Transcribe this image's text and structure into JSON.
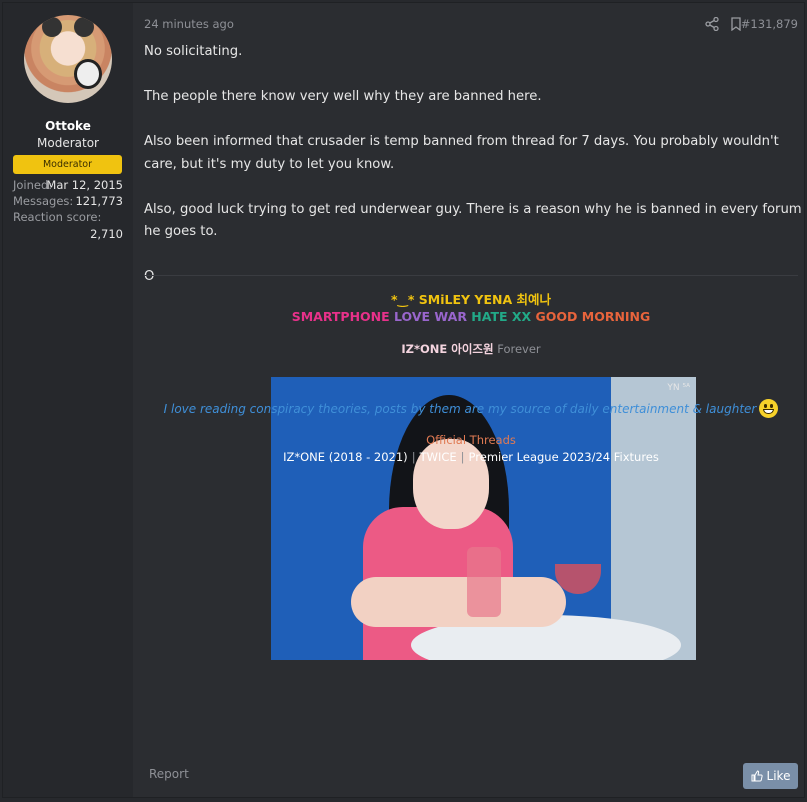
{
  "user": {
    "name": "Ottoke",
    "title": "Moderator",
    "banner": "Moderator",
    "stats": [
      {
        "label": "Joined:",
        "value": "Mar 12, 2015"
      },
      {
        "label": "Messages:",
        "value": "121,773"
      },
      {
        "label": "Reaction score:",
        "value": ""
      },
      {
        "label": "",
        "value": "2,710"
      }
    ]
  },
  "post": {
    "time": "24 minutes ago",
    "number": "#131,879",
    "paragraphs": [
      "No solicitating.",
      "The people there know very well why they are banned here.",
      "Also been informed that crusader is temp banned from thread for 7 days. You probably wouldn't care, but it's my duty to let you know.",
      "Also, good luck trying to get red underwear guy. There is a reason why he is banned in every forum he goes to.",
      "O"
    ]
  },
  "signature": {
    "line1": "*‿* SMiLEY YENA 최예나",
    "line2": {
      "smartphone": "SMARTPHONE",
      "love": " LOVE WAR ",
      "hate": "HATE XX ",
      "morning": "GOOD MORNING"
    },
    "izone": "IZ*ONE 아이즈원",
    "forever": " Forever",
    "photo_watermark": "YN ⁵ᴬ",
    "quote": "I love reading conspiracy theories, posts by them are my source of daily entertainment & laughter",
    "official_threads": "Official Threads",
    "links": [
      "IZ*ONE (2018 - 2021)",
      "TWICE",
      "Premier League 2023/24 Fixtures"
    ]
  },
  "actions": {
    "report": "Report",
    "like": "Like"
  }
}
